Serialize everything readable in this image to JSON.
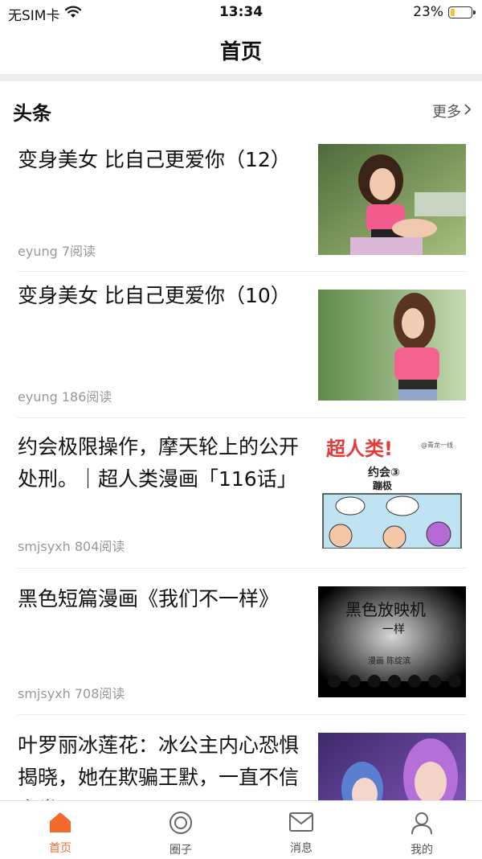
{
  "status": {
    "carrier": "无SIM卡",
    "time": "13:34",
    "battery": "23%",
    "battery_level": 0.23
  },
  "nav": {
    "title": "首页"
  },
  "section": {
    "title": "头条",
    "more": "更多"
  },
  "articles": [
    {
      "title": "变身美女 比自己更爱你（12）",
      "author": "eyung",
      "reads": "7阅读",
      "thumb_kind": "photo-girl"
    },
    {
      "title": "变身美女 比自己更爱你（10）",
      "author": "eyung",
      "reads": "186阅读",
      "thumb_kind": "photo-girl"
    },
    {
      "title": "约会极限操作，摩天轮上的公开处刑。｜超人类漫画「116话」",
      "author": "smjsyxh",
      "reads": "804阅读",
      "thumb_kind": "comic"
    },
    {
      "title": "黑色短篇漫画《我们不一样》",
      "author": "smjsyxh",
      "reads": "708阅读",
      "thumb_kind": "dark-comic"
    },
    {
      "title": "叶罗丽冰莲花：冰公主内心恐惧揭晓，她在欺骗王默，一直不信人类",
      "author": "",
      "reads": "",
      "thumb_kind": "anime"
    }
  ],
  "thumb_text": {
    "comic_title": "超人类!",
    "comic_sub": "约会③",
    "comic_sub2": "蹦极",
    "comic_corner": "@青龙一线",
    "dark_title": "黑色放映机",
    "dark_sub": "一样",
    "dark_credit": "漫画 陈绽滨"
  },
  "tabs": [
    {
      "label": "首页",
      "icon": "home-icon",
      "active": true
    },
    {
      "label": "圈子",
      "icon": "circle-icon",
      "active": false
    },
    {
      "label": "消息",
      "icon": "message-icon",
      "active": false
    },
    {
      "label": "我的",
      "icon": "profile-icon",
      "active": false
    }
  ],
  "colors": {
    "accent": "#f26b2c",
    "battery": "#f2c230"
  }
}
